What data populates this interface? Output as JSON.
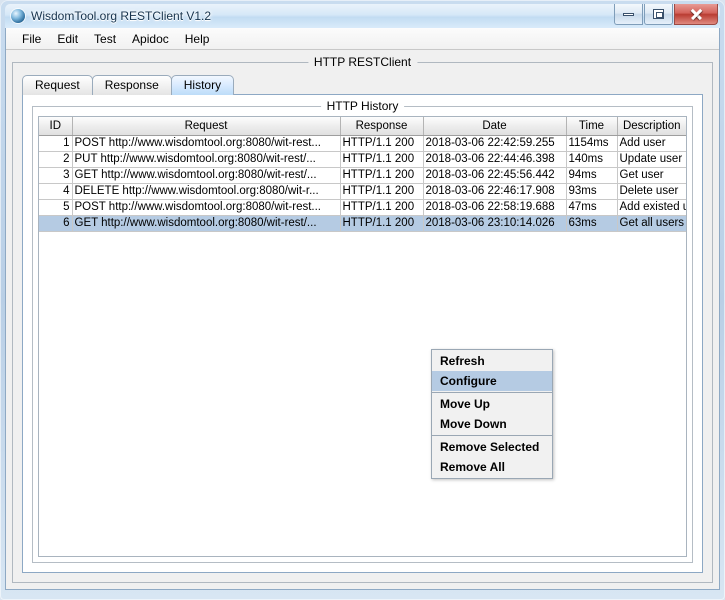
{
  "window": {
    "title": "WisdomTool.org RESTClient V1.2",
    "icon": "app-circle-icon",
    "buttons": {
      "minimize": "minimize-icon",
      "maximize": "maximize-icon",
      "close": "close-icon"
    }
  },
  "menubar": {
    "items": [
      {
        "label": "File"
      },
      {
        "label": "Edit"
      },
      {
        "label": "Test"
      },
      {
        "label": "Apidoc"
      },
      {
        "label": "Help"
      }
    ]
  },
  "main": {
    "group_title": "HTTP RESTClient",
    "inner_title": "HTTP History",
    "tabs": [
      {
        "label": "Request",
        "selected": false
      },
      {
        "label": "Response",
        "selected": false
      },
      {
        "label": "History",
        "selected": true
      }
    ]
  },
  "table": {
    "columns": [
      {
        "key": "id",
        "label": "ID"
      },
      {
        "key": "request",
        "label": "Request"
      },
      {
        "key": "response",
        "label": "Response"
      },
      {
        "key": "date",
        "label": "Date"
      },
      {
        "key": "time",
        "label": "Time"
      },
      {
        "key": "description",
        "label": "Description"
      }
    ],
    "rows": [
      {
        "id": "1",
        "request": "POST http://www.wisdomtool.org:8080/wit-rest...",
        "response": "HTTP/1.1 200",
        "date": "2018-03-06 22:42:59.255",
        "time": "1154ms",
        "description": "Add user",
        "selected": false
      },
      {
        "id": "2",
        "request": "PUT http://www.wisdomtool.org:8080/wit-rest/...",
        "response": "HTTP/1.1 200",
        "date": "2018-03-06 22:44:46.398",
        "time": "140ms",
        "description": "Update user",
        "selected": false
      },
      {
        "id": "3",
        "request": "GET http://www.wisdomtool.org:8080/wit-rest/...",
        "response": "HTTP/1.1 200",
        "date": "2018-03-06 22:45:56.442",
        "time": "94ms",
        "description": "Get user",
        "selected": false
      },
      {
        "id": "4",
        "request": "DELETE http://www.wisdomtool.org:8080/wit-r...",
        "response": "HTTP/1.1 200",
        "date": "2018-03-06 22:46:17.908",
        "time": "93ms",
        "description": "Delete user",
        "selected": false
      },
      {
        "id": "5",
        "request": "POST http://www.wisdomtool.org:8080/wit-rest...",
        "response": "HTTP/1.1 200",
        "date": "2018-03-06 22:58:19.688",
        "time": "47ms",
        "description": "Add existed user",
        "selected": false
      },
      {
        "id": "6",
        "request": "GET http://www.wisdomtool.org:8080/wit-rest/...",
        "response": "HTTP/1.1 200",
        "date": "2018-03-06 23:10:14.026",
        "time": "63ms",
        "description": "Get all users",
        "selected": true
      }
    ]
  },
  "context_menu": {
    "visible": true,
    "items": [
      {
        "label": "Refresh",
        "highlighted": false,
        "separator_after": false
      },
      {
        "label": "Configure",
        "highlighted": true,
        "separator_after": true
      },
      {
        "label": "Move Up",
        "highlighted": false,
        "separator_after": false
      },
      {
        "label": "Move Down",
        "highlighted": false,
        "separator_after": true
      },
      {
        "label": "Remove Selected",
        "highlighted": false,
        "separator_after": false
      },
      {
        "label": "Remove All",
        "highlighted": false,
        "separator_after": false
      }
    ]
  },
  "colors": {
    "selection": "#b5cbe3",
    "titlebar_text": "#16334d",
    "close_button": "#b93c32",
    "window_frame": "#c9dcef"
  }
}
